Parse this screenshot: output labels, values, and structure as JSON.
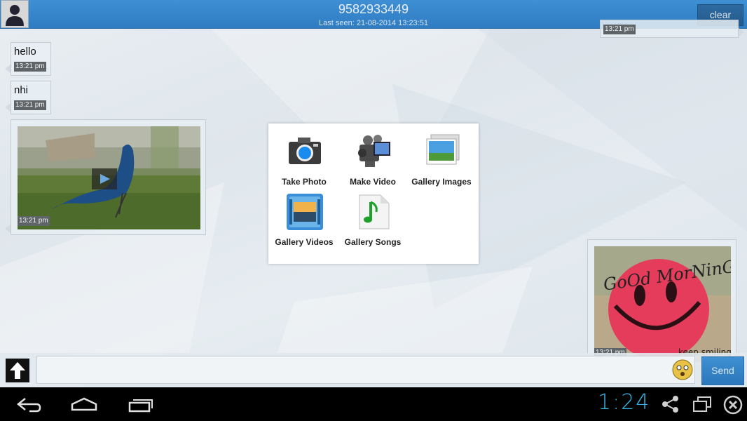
{
  "header": {
    "title": "9582933449",
    "subtitle": "Last seen: 21-08-2014 13:23:51",
    "clear_label": "clear"
  },
  "messages": [
    {
      "text": "hello",
      "time": "13:21 pm",
      "side": "left"
    },
    {
      "text": "nhi",
      "time": "13:21 pm",
      "side": "left"
    },
    {
      "type": "video",
      "time": "13:21 pm",
      "side": "left"
    },
    {
      "type": "image",
      "time": "13:21 pm",
      "side": "right",
      "caption_top": "GoOd MorNinG",
      "caption_bottom": "keep smiling"
    },
    {
      "type": "partial",
      "time": "13:21 pm",
      "side": "right"
    }
  ],
  "dialog": {
    "options": [
      {
        "label": "Take Photo",
        "icon": "camera-icon"
      },
      {
        "label": "Make Video",
        "icon": "video-camera-icon"
      },
      {
        "label": "Gallery Images",
        "icon": "gallery-images-icon"
      },
      {
        "label": "Gallery Videos",
        "icon": "gallery-videos-icon"
      },
      {
        "label": "Gallery Songs",
        "icon": "music-note-icon"
      }
    ]
  },
  "composer": {
    "placeholder": "",
    "send_label": "Send"
  },
  "system": {
    "clock": "1:24",
    "accent": "#33b5e5"
  }
}
